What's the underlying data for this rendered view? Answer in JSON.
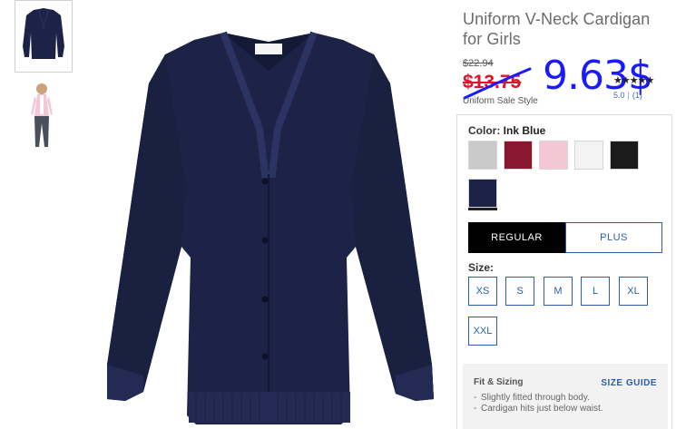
{
  "product": {
    "title": "Uniform V-Neck Cardigan for Girls",
    "original_price": "$22.94",
    "sale_price": "$13.75",
    "handwritten_price": "9.63$",
    "sale_style_label": "Uniform Sale Style",
    "rating_stars": "★★★★★",
    "rating_value": "5.0",
    "review_count": "(1)"
  },
  "thumbnails": [
    {
      "name": "cardigan-flat",
      "selected": true
    },
    {
      "name": "cardigan-on-model",
      "selected": false
    }
  ],
  "color": {
    "label": "Color:",
    "selected_name": "Ink Blue",
    "swatches": [
      {
        "name": "heather-gray",
        "hex": "#c9c9c9"
      },
      {
        "name": "burgundy",
        "hex": "#8a1730"
      },
      {
        "name": "pink",
        "hex": "#f3c8d4"
      },
      {
        "name": "white",
        "hex": "#f3f3f3"
      },
      {
        "name": "black",
        "hex": "#1b1b1b"
      },
      {
        "name": "ink-blue",
        "hex": "#1c2346",
        "selected": true
      }
    ]
  },
  "fit_options": {
    "regular": "REGULAR",
    "plus": "PLUS",
    "selected": "REGULAR"
  },
  "size": {
    "label": "Size:",
    "options": [
      "XS",
      "S",
      "M",
      "L",
      "XL",
      "XXL"
    ]
  },
  "fit_sizing": {
    "title": "Fit & Sizing",
    "size_guide": "SIZE GUIDE",
    "notes": [
      "Slightly fitted through body.",
      "Cardigan hits just below waist."
    ]
  },
  "colors": {
    "accent": "#2a5ea8",
    "sale_red": "#e0132a",
    "handwriting_blue": "#1a1aff",
    "cardigan_navy": "#1c2346"
  }
}
